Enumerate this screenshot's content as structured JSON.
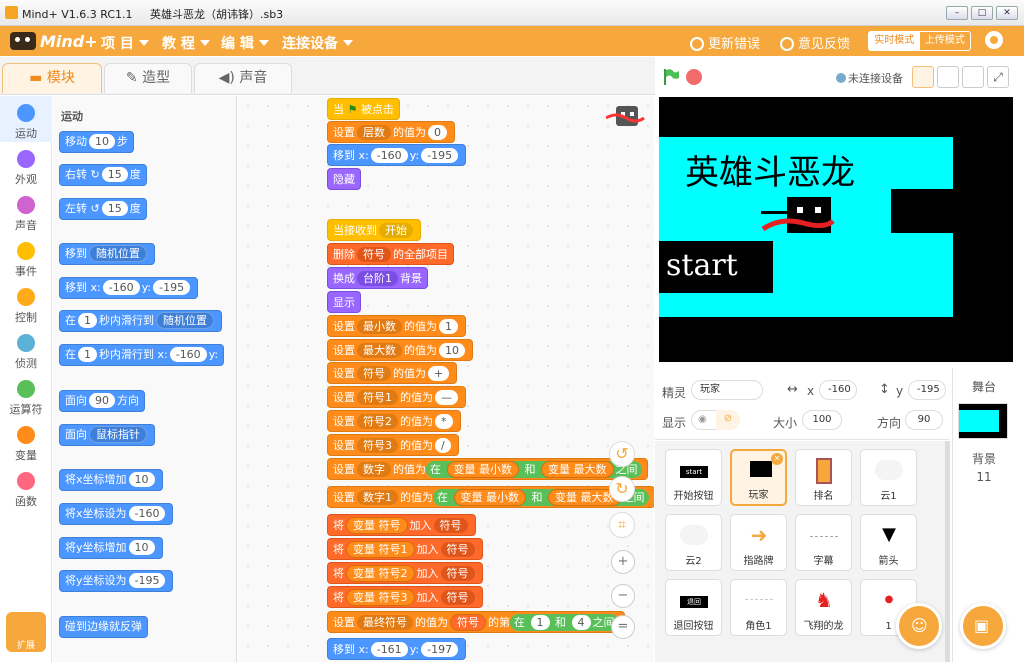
{
  "window": {
    "title": "Mind+ V1.6.3 RC1.1     英雄斗恶龙（胡讳锋）.sb3"
  },
  "menubar": {
    "logo": "Mind+",
    "items": [
      "项 目",
      "教 程",
      "编 辑",
      "连接设备"
    ],
    "update_errors": "更新错误",
    "feedback": "意见反馈",
    "mode_realtime": "实时模式",
    "mode_upload": "上传模式"
  },
  "tabs": {
    "blocks": "模块",
    "costumes": "造型",
    "sounds": "声音"
  },
  "stage_controls": {
    "connection": "未连接设备"
  },
  "categories": [
    {
      "label": "运动",
      "color": "#4c97ff"
    },
    {
      "label": "外观",
      "color": "#9966ff"
    },
    {
      "label": "声音",
      "color": "#cf63cf"
    },
    {
      "label": "事件",
      "color": "#ffbf00"
    },
    {
      "label": "控制",
      "color": "#ffab19"
    },
    {
      "label": "侦测",
      "color": "#5cb1d6"
    },
    {
      "label": "运算符",
      "color": "#59c059"
    },
    {
      "label": "变量",
      "color": "#ff8c1a"
    },
    {
      "label": "函数",
      "color": "#ff6680"
    }
  ],
  "extension_label": "扩展",
  "palette": {
    "section": "运动",
    "move": {
      "a": "移动",
      "v": "10",
      "b": "步"
    },
    "turn_right": {
      "a": "右转",
      "v": "15",
      "b": "度"
    },
    "turn_left": {
      "a": "左转",
      "v": "15",
      "b": "度"
    },
    "goto": {
      "a": "移到",
      "dd": "随机位置"
    },
    "goto_xy": {
      "a": "移到 x:",
      "x": "-160",
      "b": "y:",
      "y": "-195"
    },
    "glide": {
      "a": "在",
      "v": "1",
      "b": "秒内滑行到",
      "dd": "随机位置"
    },
    "glide_xy": {
      "a": "在",
      "v": "1",
      "b": "秒内滑行到 x:",
      "x": "-160",
      "c": "y:"
    },
    "point_dir": {
      "a": "面向",
      "v": "90",
      "b": "方向"
    },
    "point_towards": {
      "a": "面向",
      "dd": "鼠标指针"
    },
    "change_x": {
      "a": "将x坐标增加",
      "v": "10"
    },
    "set_x": {
      "a": "将x坐标设为",
      "v": "-160"
    },
    "change_y": {
      "a": "将y坐标增加",
      "v": "10"
    },
    "set_y": {
      "a": "将y坐标设为",
      "v": "-195"
    },
    "bounce": "碰到边缘就反弹"
  },
  "script": {
    "hat1": {
      "a": "当",
      "b": "被点击"
    },
    "s1": {
      "a": "设置",
      "dd": "层数",
      "b": "的值为",
      "v": "0"
    },
    "s2": {
      "a": "移到 x:",
      "x": "-160",
      "b": "y:",
      "y": "-195"
    },
    "s3": "隐藏",
    "hat2": {
      "a": "当接收到",
      "dd": "开始"
    },
    "s4": {
      "a": "删除",
      "dd": "符号",
      "b": "的全部项目"
    },
    "s5": {
      "a": "换成",
      "dd": "台阶1",
      "b": "背景"
    },
    "s6": "显示",
    "s7": {
      "a": "设置",
      "dd": "最小数",
      "b": "的值为",
      "v": "1"
    },
    "s8": {
      "a": "设置",
      "dd": "最大数",
      "b": "的值为",
      "v": "10"
    },
    "s9": {
      "a": "设置",
      "dd": "符号",
      "b": "的值为",
      "v": "+"
    },
    "s10": {
      "a": "设置",
      "dd": "符号1",
      "b": "的值为",
      "v": "—"
    },
    "s11": {
      "a": "设置",
      "dd": "符号2",
      "b": "的值为",
      "v": "*"
    },
    "s12": {
      "a": "设置",
      "dd": "符号3",
      "b": "的值为",
      "v": "/"
    },
    "s13": {
      "a": "设置",
      "dd": "数字",
      "b": "的值为",
      "c": "在",
      "v1": "变量 最小数",
      "d": "和",
      "v2": "变量 最大数",
      "e": "之间"
    },
    "s14": {
      "a": "设置",
      "dd": "数字1",
      "b": "的值为",
      "c": "在",
      "v1": "变量 最小数",
      "d": "和",
      "v2": "变量 最大数",
      "e": "之间"
    },
    "s15": {
      "a": "将",
      "v": "变量 符号",
      "b": "加入",
      "dd": "符号"
    },
    "s16": {
      "a": "将",
      "v": "变量 符号1",
      "b": "加入",
      "dd": "符号"
    },
    "s17": {
      "a": "将",
      "v": "变量 符号2",
      "b": "加入",
      "dd": "符号"
    },
    "s18": {
      "a": "将",
      "v": "变量 符号3",
      "b": "加入",
      "dd": "符号"
    },
    "s19": {
      "a": "设置",
      "dd": "最终符号",
      "b": "的值为",
      "dd2": "符号",
      "c": "的第",
      "d": "在",
      "v1": "1",
      "e": "和",
      "v2": "4",
      "f": "之间"
    },
    "s20": {
      "a": "移到 x:",
      "x": "-161",
      "b": "y:",
      "y": "-197"
    }
  },
  "stage": {
    "title": "英雄斗恶龙",
    "start": "start"
  },
  "sprite_info": {
    "sprite_label": "精灵",
    "sprite_name": "玩家",
    "x_label": "x",
    "x": "-160",
    "y_label": "y",
    "y": "-195",
    "show_label": "显示",
    "size_label": "大小",
    "size": "100",
    "dir_label": "方向",
    "dir": "90"
  },
  "sprites": [
    "开始按钮",
    "玩家",
    "排名",
    "云1",
    "云2",
    "指路牌",
    "字幕",
    "箭头",
    "退回按钮",
    "角色1",
    "飞翔的龙",
    "1"
  ],
  "sprite_thumbs": {
    "start": "start",
    "back": "退回"
  },
  "stage_panel": {
    "title": "舞台",
    "backdrop_label": "背景",
    "backdrop_count": "11"
  }
}
